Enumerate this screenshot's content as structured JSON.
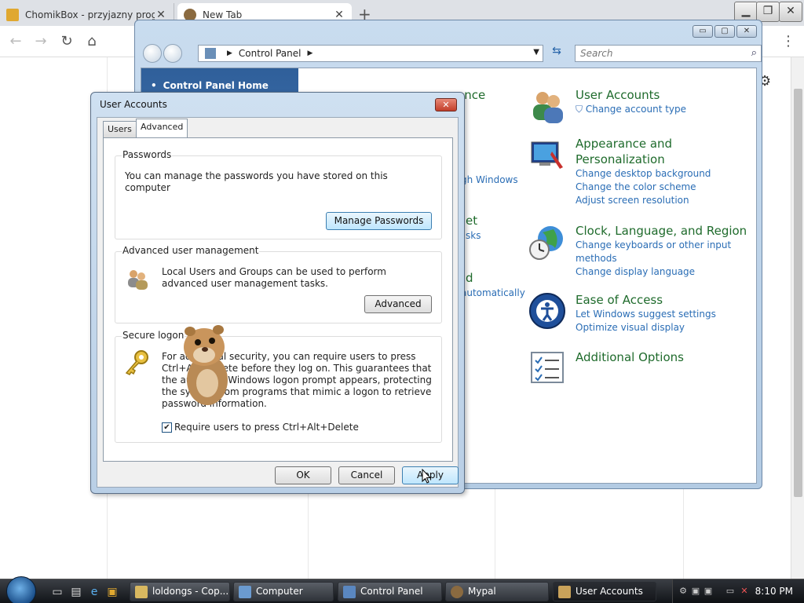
{
  "browser": {
    "tabs": [
      {
        "title": "ChomikBox - przyjazny program",
        "close": "✕"
      },
      {
        "title": "New Tab",
        "close": "✕"
      }
    ],
    "new_tab": "+",
    "toolbar_icons": [
      "back-icon",
      "forward-icon",
      "reload-icon",
      "home-icon"
    ],
    "window_controls": [
      "minimize",
      "restore",
      "close"
    ],
    "menu_icon": "⋮",
    "settings_icon": "⚙"
  },
  "control_panel": {
    "title_buttons": [
      "▭",
      "▢",
      "✕"
    ],
    "address_root": "Control Panel",
    "search_placeholder": "Search",
    "sidebar": {
      "home": "Control Panel Home"
    },
    "partial": {
      "t1": "ance",
      "t2": "gh Windows",
      "t3": "et",
      "t4": "sks",
      "t5": "d",
      "t6": "automatically"
    },
    "categories": [
      {
        "title": "User Accounts",
        "links": [
          "Change account type"
        ]
      },
      {
        "title": "Appearance and Personalization",
        "links": [
          "Change desktop background",
          "Change the color scheme",
          "Adjust screen resolution"
        ]
      },
      {
        "title": "Clock, Language, and Region",
        "links": [
          "Change keyboards or other input methods",
          "Change display language"
        ]
      },
      {
        "title": "Ease of Access",
        "links": [
          "Let Windows suggest settings",
          "Optimize visual display"
        ]
      },
      {
        "title": "Additional Options",
        "links": []
      }
    ]
  },
  "dialog": {
    "title": "User Accounts",
    "close": "✕",
    "tabs": [
      "Users",
      "Advanced"
    ],
    "passwords": {
      "label": "Passwords",
      "text": "You can manage the passwords you have stored on this computer",
      "button": "Manage Passwords"
    },
    "advanced_mgmt": {
      "label": "Advanced user management",
      "text": "Local Users and Groups can be used to perform advanced user management tasks.",
      "button": "Advanced"
    },
    "secure_logon": {
      "label": "Secure logon",
      "text": "For additional security, you can require users to press Ctrl+Alt+Delete before they log on. This guarantees that the authentic Windows logon prompt appears, protecting the system from programs that mimic a logon to retrieve password information.",
      "checkbox_label": "Require users to press Ctrl+Alt+Delete",
      "checked": true
    },
    "buttons": {
      "ok": "OK",
      "cancel": "Cancel",
      "apply": "Apply"
    }
  },
  "taskbar": {
    "items": [
      {
        "label": "loldongs - Cop..."
      },
      {
        "label": "Computer"
      },
      {
        "label": "Control Panel"
      },
      {
        "label": "Mypal"
      },
      {
        "label": "User Accounts"
      }
    ],
    "clock": "8:10 PM"
  },
  "colors": {
    "category_title": "#1f6b2c",
    "link": "#2a6db5",
    "sidebar": "#2f5f9a"
  }
}
